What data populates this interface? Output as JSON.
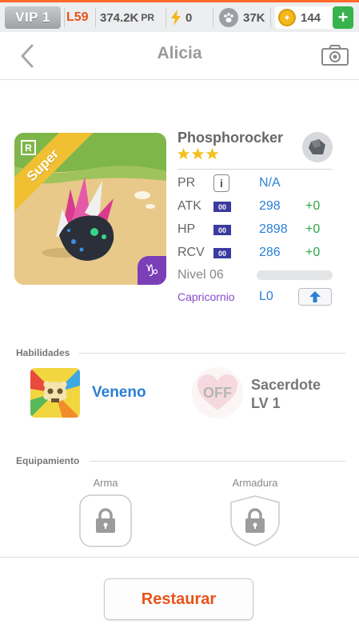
{
  "topbar": {
    "vip": "VIP 1",
    "level": "L59",
    "power": "374.2K",
    "power_unit": "PR",
    "energy": "0",
    "paws": "37K",
    "coins": "144",
    "add_label": "+"
  },
  "header": {
    "back_icon": "chevron-left-icon",
    "title": "Alicia",
    "camera_icon": "camera-icon"
  },
  "card": {
    "rarity_tag": "R",
    "banner": "Super",
    "zodiac_symbol": "♑"
  },
  "monster": {
    "name": "Phosphorocker",
    "stars": 3,
    "element_icon": "rock-element-icon",
    "stats": {
      "pr": {
        "label": "PR",
        "value": "N/A"
      },
      "atk": {
        "label": "ATK",
        "tag": "00",
        "value": "298",
        "bonus": "+0"
      },
      "hp": {
        "label": "HP",
        "tag": "00",
        "value": "2898",
        "bonus": "+0"
      },
      "rcv": {
        "label": "RCV",
        "tag": "00",
        "value": "286",
        "bonus": "+0"
      }
    },
    "level_label": "Nivel 06",
    "level_progress": 0,
    "zodiac_label": "Capricornio",
    "zodiac_level": "L0"
  },
  "skills": {
    "section_title": "Habilidades",
    "active_skill": "Veneno",
    "leader_status": "OFF",
    "leader_skill_name": "Sacerdote",
    "leader_skill_level": "LV 1"
  },
  "equipment": {
    "section_title": "Equipamiento",
    "weapon_label": "Arma",
    "armor_label": "Armadura"
  },
  "actions": {
    "restore_label": "Restaurar"
  },
  "colors": {
    "accent": "#e8531b",
    "value_blue": "#2b7fd4",
    "bonus_green": "#2fa84a",
    "zodiac_purple": "#8a4bc6"
  }
}
